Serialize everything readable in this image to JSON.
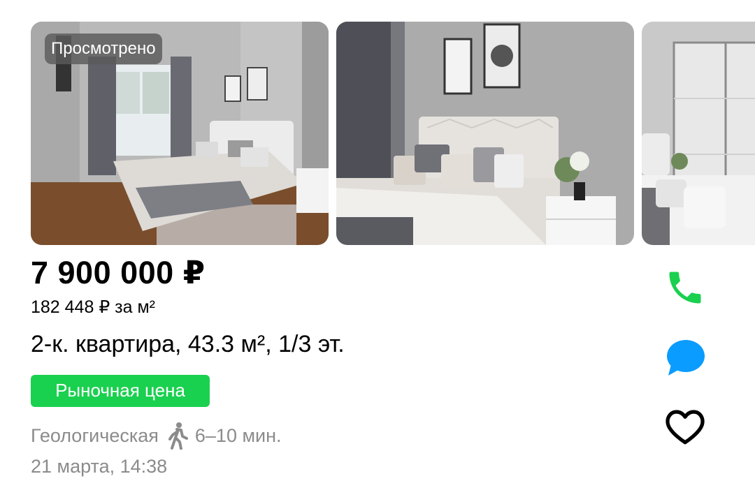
{
  "gallery": {
    "viewed_badge": "Просмотрено",
    "photos": [
      "bedroom-window-photo",
      "bedroom-bed-photo",
      "bedroom-wardrobe-photo"
    ]
  },
  "listing": {
    "price": "7 900 000 ₽",
    "price_per_m2": "182 448 ₽ за м²",
    "title": "2-к. квартира, 43.3 м², 1/3 эт.",
    "price_tag": "Рыночная цена",
    "metro_station": "Геологическая",
    "metro_time": "6–10 мин.",
    "date": "21 марта, 14:38"
  },
  "actions": {
    "call_icon": "phone-icon",
    "chat_icon": "chat-bubble-icon",
    "favorite_icon": "heart-icon"
  },
  "colors": {
    "price_tag_bg": "#1ad04f",
    "call_icon": "#1ad04f",
    "chat_icon": "#0a9cff",
    "secondary_text": "#8b8b8b"
  }
}
